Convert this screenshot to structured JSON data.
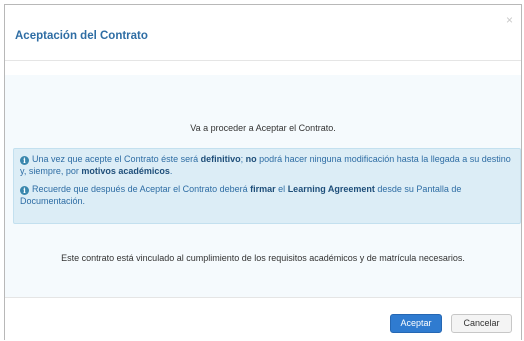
{
  "modal": {
    "title": "Aceptación del Contrato",
    "close_glyph": "×"
  },
  "body": {
    "intro": "Va a proceder a Aceptar el Contrato.",
    "info_icon": "info-circle-icon",
    "alert1": {
      "p1": "Una vez que acepte el Contrato éste será ",
      "b1": "definitivo",
      "p2": "; ",
      "b2": "no",
      "p3": " podrá hacer ninguna modificación hasta la llegada a su destino y, siempre, por ",
      "b3": "motivos académicos",
      "p4": "."
    },
    "alert2": {
      "p1": "Recuerde que después de Aceptar el Contrato deberá ",
      "b1": "firmar",
      "p2": " el ",
      "b2": "Learning Agreement",
      "p3": " desde su Pantalla de Documentación."
    },
    "note": "Este contrato está vinculado al cumplimiento de los requisitos académicos y de matrícula necesarios."
  },
  "footer": {
    "accept_label": "Aceptar",
    "cancel_label": "Cancelar"
  },
  "colors": {
    "title": "#2e6da4",
    "alert_bg": "#dcedf6",
    "primary_button": "#2f7bd0"
  }
}
